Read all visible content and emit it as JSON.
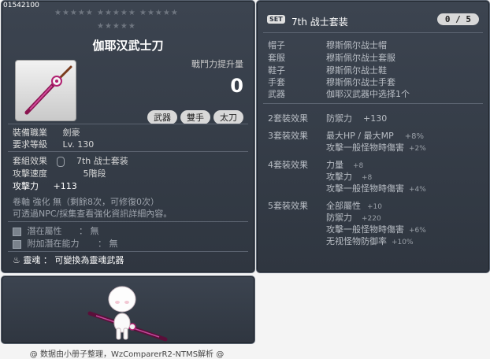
{
  "item": {
    "code": "01542100",
    "title": "伽耶汉武士刀",
    "power_label": "戰鬥力提升量",
    "power_value": "0",
    "tags": [
      "武器",
      "雙手",
      "太刀"
    ],
    "job_label": "裝備職業",
    "job_value": "劍豪",
    "level_label": "要求等級",
    "level_value": "Lv. 130",
    "set_label": "套組效果",
    "set_value": "7th 战士套装",
    "speed_label": "攻擊速度",
    "speed_value": "5階段",
    "attack_label": "攻擊力",
    "attack_value": "+113",
    "scroll_text": "卷軸 強化 無（剩餘8次，可修復0次）",
    "npc_text": "可透過NPC/採集查看強化資訊詳細內容。",
    "potential_label": "潛在屬性",
    "potential_value": "無",
    "bonus_label": "附加潛在能力",
    "bonus_value": "無",
    "soul_label": "靈魂",
    "soul_value": "可變換為靈魂武器"
  },
  "set": {
    "badge": "SET",
    "title": "7th 战士套装",
    "count": "0 / 5",
    "parts": [
      {
        "slot": "帽子",
        "name": "穆斯佩尔战士帽"
      },
      {
        "slot": "套服",
        "name": "穆斯佩尔战士套服"
      },
      {
        "slot": "鞋子",
        "name": "穆斯佩尔战士鞋"
      },
      {
        "slot": "手套",
        "name": "穆斯佩尔战士手套"
      },
      {
        "slot": "武器",
        "name": "伽耶汉武器中选择1个"
      }
    ],
    "effects": {
      "e2_label": "2套裝效果",
      "e2_l1": "防禦力",
      "e2_v1": "+130",
      "e3_label": "3套裝效果",
      "e3_l1": "最大HP / 最大MP",
      "e3_v1": "+8%",
      "e3_l2": "攻擊一般怪物時傷害",
      "e3_v2": "+2%",
      "e4_label": "4套裝效果",
      "e4_l1": "力量",
      "e4_v1": "+8",
      "e4_l2": "攻擊力",
      "e4_v2": "+8",
      "e4_l3": "攻擊一般怪物時傷害",
      "e4_v3": "+4%",
      "e5_label": "5套裝效果",
      "e5_l1": "全部屬性",
      "e5_v1": "+10",
      "e5_l2": "防禦力",
      "e5_v2": "+220",
      "e5_l3": "攻擊一般怪物時傷害",
      "e5_v3": "+6%",
      "e5_l4": "无视怪物防御率",
      "e5_v4": "+10%"
    }
  },
  "footer": "@ 数据由小册子整理，WzComparerR2-NTMS解析 @"
}
